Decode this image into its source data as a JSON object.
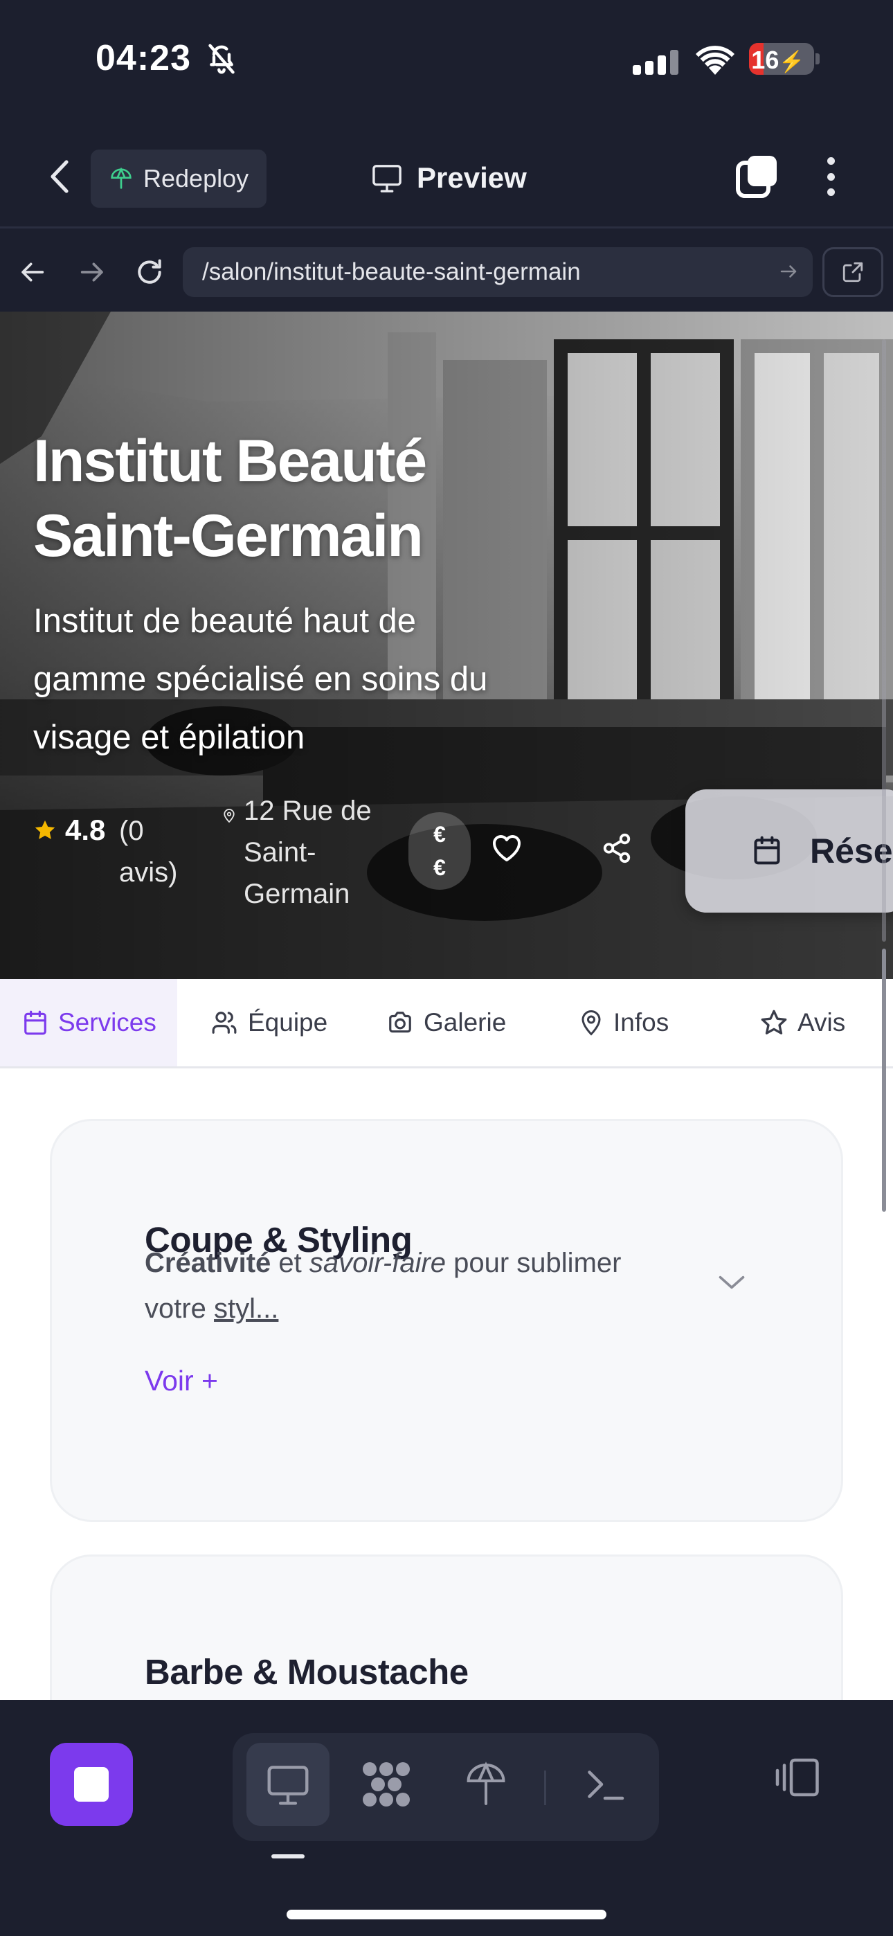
{
  "status": {
    "time": "04:23",
    "battery": "16",
    "battery_level": 0.16
  },
  "header": {
    "redeploy_label": "Redeploy",
    "preview_label": "Preview"
  },
  "url": {
    "path": "/salon/institut-beaute-saint-germain"
  },
  "hero": {
    "title": "Institut Beauté Saint-Germain",
    "description": "Institut de beauté haut de gamme spécialisé en soins du visage et épilation",
    "rating": "4.8",
    "review_count": "(0 avis)",
    "address": "12 Rue de Saint-Germain",
    "price_top": "€",
    "price_bottom": "€",
    "book_label": "Réserver"
  },
  "tabs": [
    {
      "label": "Services",
      "icon": "calendar-icon"
    },
    {
      "label": "Équipe",
      "icon": "users-icon"
    },
    {
      "label": "Galerie",
      "icon": "camera-icon"
    },
    {
      "label": "Infos",
      "icon": "map-pin-icon"
    },
    {
      "label": "Avis",
      "icon": "star-icon"
    }
  ],
  "categories": [
    {
      "title": "Coupe & Styling",
      "desc_bold": "Créativité",
      "desc_mid1": " et ",
      "desc_italic": "savoir-faire",
      "desc_mid2": " pour sublimer votre ",
      "desc_underline": "styl...",
      "more_label": "Voir +"
    },
    {
      "title": "Barbe & Moustache"
    }
  ],
  "colors": {
    "accent": "#7c3aed",
    "app_bg": "#1c1f2e",
    "star": "#f5b800"
  }
}
